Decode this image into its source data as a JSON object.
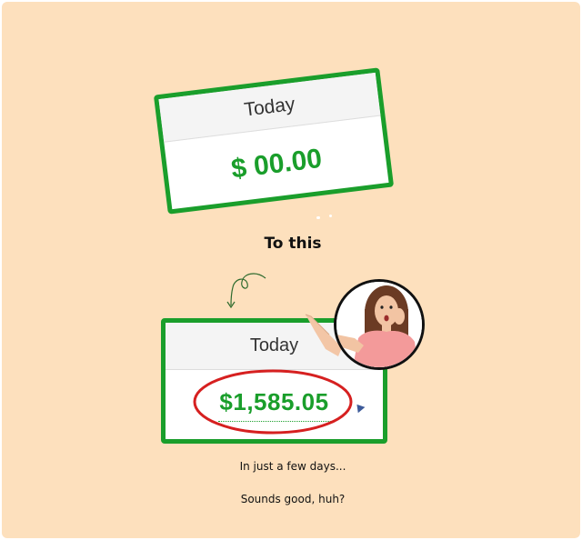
{
  "top_card": {
    "header": "Today",
    "amount": "$ 00.00"
  },
  "transition_text": "To this",
  "bottom_card": {
    "header": "Today",
    "amount": "$1,585.05"
  },
  "captions": {
    "line1": "In just a few days...",
    "line2": "Sounds good, huh?"
  },
  "colors": {
    "background": "#fde0bd",
    "card_border": "#1a9e2b",
    "amount_text": "#1a9e2b",
    "highlight_ellipse": "#d62020"
  },
  "icons": {
    "doodle": "curly-arrow-icon",
    "avatar": "surprised-woman-photo"
  }
}
